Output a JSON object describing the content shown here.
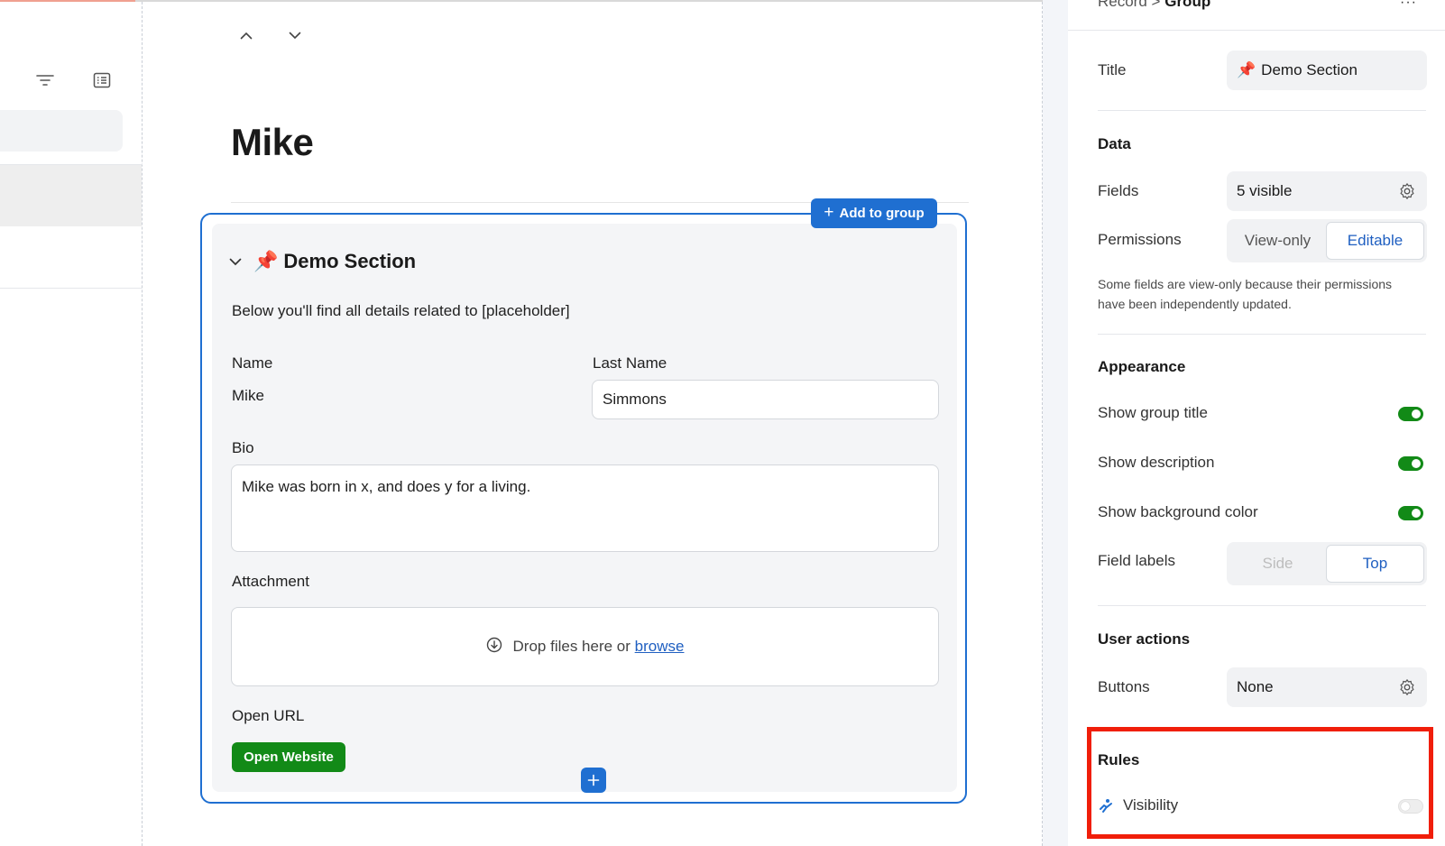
{
  "center": {
    "record_title": "Mike",
    "add_to_group_label": "Add to group",
    "section": {
      "emoji": "📌",
      "title": "Demo Section",
      "description": "Below you'll find all details related to [placeholder]"
    },
    "fields": {
      "name_label": "Name",
      "name_value": "Mike",
      "last_name_label": "Last Name",
      "last_name_value": "Simmons",
      "bio_label": "Bio",
      "bio_value": "Mike was born in x, and does y for a living.",
      "attachment_label": "Attachment",
      "drop_text": "Drop files here or",
      "browse_link": "browse",
      "open_url_label": "Open URL",
      "open_website_button": "Open Website"
    }
  },
  "right_panel": {
    "breadcrumb_parent": "Record",
    "breadcrumb_sep": ">",
    "breadcrumb_current": "Group",
    "more_menu": "···",
    "title_label": "Title",
    "title_emoji": "📌",
    "title_value": "Demo Section",
    "data_heading": "Data",
    "fields_label": "Fields",
    "fields_value": "5 visible",
    "permissions_label": "Permissions",
    "permissions_options": [
      "View-only",
      "Editable"
    ],
    "permissions_selected": "Editable",
    "permissions_note": "Some fields are view-only because their permissions have been independently updated.",
    "appearance_heading": "Appearance",
    "show_group_title_label": "Show group title",
    "show_group_title": true,
    "show_description_label": "Show description",
    "show_description": true,
    "show_background_label": "Show background color",
    "show_background": true,
    "field_labels_label": "Field labels",
    "field_labels_options": [
      "Side",
      "Top"
    ],
    "field_labels_selected": "Top",
    "user_actions_heading": "User actions",
    "buttons_label": "Buttons",
    "buttons_value": "None",
    "rules_heading": "Rules",
    "visibility_label": "Visibility",
    "visibility": false
  },
  "colors": {
    "accent_blue": "#1f6fd1",
    "action_green": "#128a17",
    "highlight_red": "#f01e0a"
  }
}
